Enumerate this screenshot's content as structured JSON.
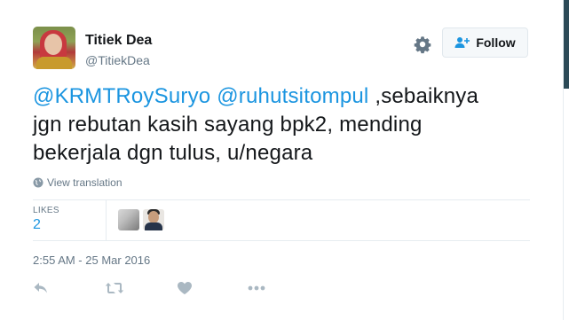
{
  "author": {
    "name": "Titiek Dea",
    "handle": "@TitiekDea"
  },
  "actions_top": {
    "follow_label": "Follow"
  },
  "tweet": {
    "mention_1": "@KRMTRoySuryo",
    "mention_2": "@ruhutsitompul",
    "line_1_rest": " ,sebaiknya",
    "line_2": "jgn rebutan kasih sayang bpk2, mending",
    "line_3": "bekerjala dgn tulus, u/negara",
    "translate_label": "View translation"
  },
  "stats": {
    "likes_label": "LIKES",
    "likes_count": "2"
  },
  "timestamp": "2:55 AM - 25 Mar 2016",
  "colors": {
    "link": "#1b95e0",
    "text": "#14171a",
    "muted": "#657786",
    "icon": "#aab8c2"
  },
  "icons": [
    "gear-icon",
    "follow-person-icon",
    "globe-icon",
    "reply-icon",
    "retweet-icon",
    "heart-icon",
    "more-icon"
  ]
}
